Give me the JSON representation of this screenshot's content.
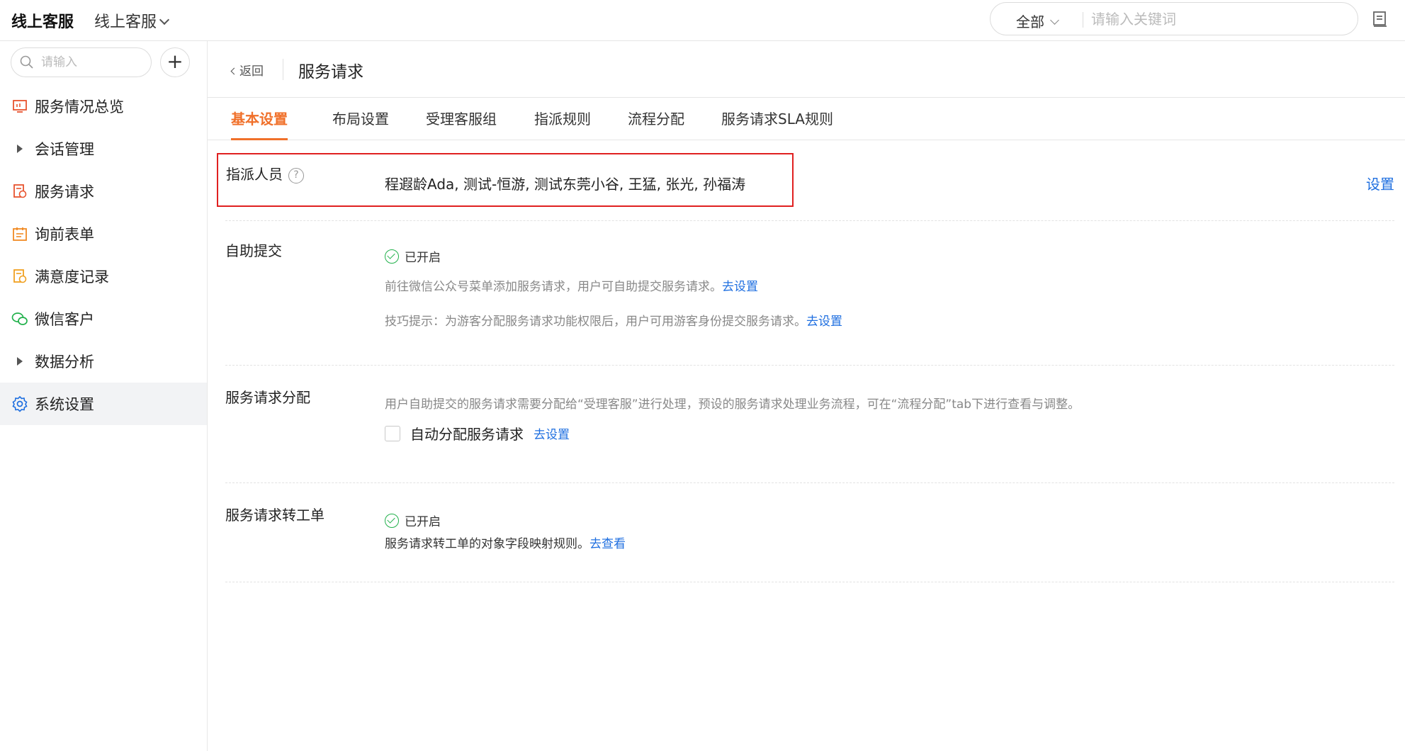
{
  "topbar": {
    "app_title": "线上客服",
    "app_switch": "线上客服",
    "search_scope": "全部",
    "search_placeholder": "请输入关键词"
  },
  "sidebar": {
    "search_placeholder": "请输入",
    "add_label": "+",
    "items": [
      {
        "label": "服务情况总览",
        "icon": "monitor-icon"
      },
      {
        "label": "会话管理",
        "icon": "caret-right-icon"
      },
      {
        "label": "服务请求",
        "icon": "request-icon"
      },
      {
        "label": "询前表单",
        "icon": "form-icon"
      },
      {
        "label": "满意度记录",
        "icon": "record-icon"
      },
      {
        "label": "微信客户",
        "icon": "wechat-icon"
      },
      {
        "label": "数据分析",
        "icon": "caret-right-icon"
      },
      {
        "label": "系统设置",
        "icon": "gear-icon",
        "active": true
      }
    ]
  },
  "header": {
    "back_label": "返回",
    "title": "服务请求"
  },
  "tabs": [
    {
      "label": "基本设置",
      "active": true
    },
    {
      "label": "布局设置"
    },
    {
      "label": "受理客服组"
    },
    {
      "label": "指派规则"
    },
    {
      "label": "流程分配"
    },
    {
      "label": "服务请求SLA规则"
    }
  ],
  "sections": {
    "assignee": {
      "label": "指派人员",
      "help": "?",
      "value": "程遐龄Ada, 测试-恒游, 测试东莞小谷, 王猛, 张光, 孙福涛",
      "action": "设置"
    },
    "self_submit": {
      "label": "自助提交",
      "status": "已开启",
      "desc1": "前往微信公众号菜单添加服务请求，用户可自助提交服务请求。",
      "desc1_link": "去设置",
      "desc2": "技巧提示：为游客分配服务请求功能权限后，用户可用游客身份提交服务请求。",
      "desc2_link": "去设置"
    },
    "distribution": {
      "label": "服务请求分配",
      "desc": "用户自助提交的服务请求需要分配给“受理客服”进行处理，预设的服务请求处理业务流程，可在“流程分配”tab下进行查看与调整。",
      "checkbox_label": "自动分配服务请求",
      "checkbox_checked": false,
      "link": "去设置"
    },
    "to_ticket": {
      "label": "服务请求转工单",
      "status": "已开启",
      "desc": "服务请求转工单的对象字段映射规则。",
      "link": "去查看"
    }
  },
  "colors": {
    "accent": "#f0702a",
    "link": "#1f6fe0",
    "highlight_border": "#e02020",
    "status_ok": "#22b14c"
  }
}
